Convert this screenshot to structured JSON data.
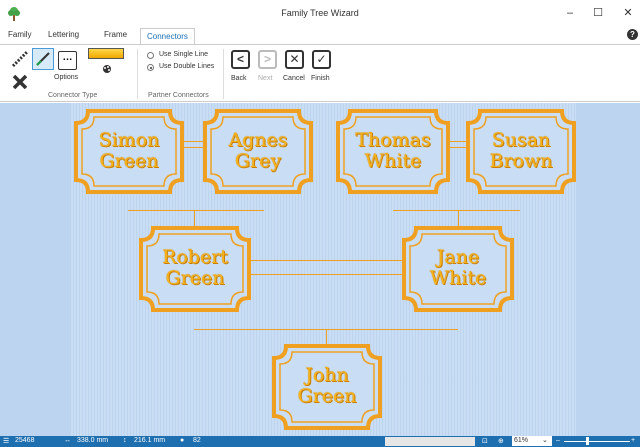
{
  "window": {
    "title": "Family Tree Wizard",
    "minimize": "–",
    "maximize": "☐",
    "close": "✕"
  },
  "tabs": [
    {
      "label": "Family"
    },
    {
      "label": "Lettering"
    },
    {
      "label": "Frame"
    },
    {
      "label": "Connectors"
    }
  ],
  "help": "?",
  "ribbon": {
    "options_label": "Options",
    "connector_type_label": "Connector Type",
    "partner_connectors_label": "Partner Connectors",
    "use_single_line": "Use Single Line",
    "use_double_lines": "Use Double Lines",
    "selected_mode": "double",
    "back_label": "Back",
    "next_label": "Next",
    "cancel_label": "Cancel",
    "finish_label": "Finish",
    "color_swatch": "#f5b800"
  },
  "tree": {
    "people": [
      {
        "first": "Simon",
        "last": "Green"
      },
      {
        "first": "Agnes",
        "last": "Grey"
      },
      {
        "first": "Thomas",
        "last": "White"
      },
      {
        "first": "Susan",
        "last": "Brown"
      },
      {
        "first": "Robert",
        "last": "Green"
      },
      {
        "first": "Jane",
        "last": "White"
      },
      {
        "first": "John",
        "last": "Green"
      }
    ],
    "frame_color": "#f0a020",
    "fill_color": "#c9def5",
    "text_color": "#f6b21b"
  },
  "status": {
    "stitches": "25468",
    "width": "338.0 mm",
    "height": "216.1 mm",
    "colors": "82",
    "zoom": "61%"
  }
}
